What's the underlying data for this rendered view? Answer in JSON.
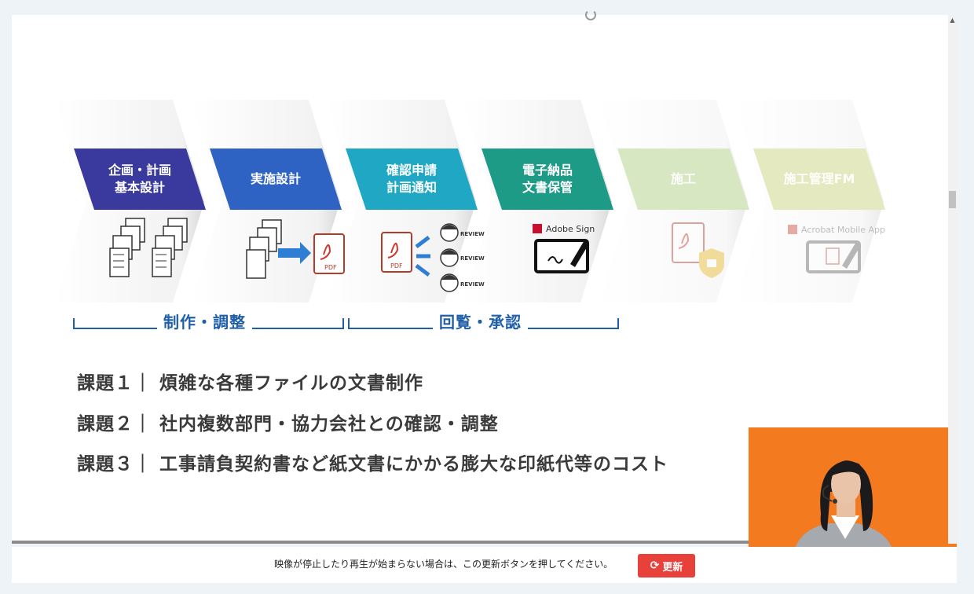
{
  "stages": [
    {
      "label": "企画・計画\n基本設計",
      "color": "#3a3a9e"
    },
    {
      "label": "実施設計",
      "color": "#2e63c4"
    },
    {
      "label": "確認申請\n計画通知",
      "color": "#1fa7c4"
    },
    {
      "label": "電子納品\n文書保管",
      "color": "#1e9b87"
    },
    {
      "label": "施工",
      "color": "#d7e7c1"
    },
    {
      "label": "施工管理FM",
      "color": "#e5e9bf"
    }
  ],
  "groups": {
    "production": "制作・調整",
    "review": "回覧・承認"
  },
  "icons": {
    "pdf_label": "PDF",
    "review_label": "REVIEW",
    "adobe_sign": "Adobe Sign",
    "acrobat_mobile": "Acrobat Mobile App"
  },
  "issues": [
    "課題１｜ 煩雑な各種ファイルの文書制作",
    "課題２｜ 社内複数部門・協力会社との確認・調整",
    "課題３｜ 工事請負契約書など紙文書にかかる膨大な印紙代等のコスト"
  ],
  "footer": {
    "notice": "映像が停止したり再生が始まらない場合は、この更新ボタンを押してください。",
    "refresh_label": "更新"
  },
  "colors": {
    "accent": "#1f5fa8",
    "refresh": "#e8403a",
    "webcam_bg": "#f47a1f"
  }
}
